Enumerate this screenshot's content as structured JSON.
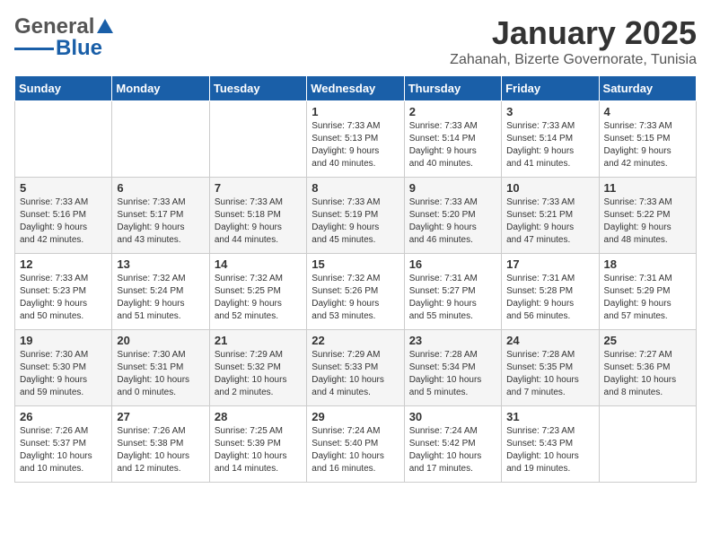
{
  "header": {
    "logo_general": "General",
    "logo_blue": "Blue",
    "month_title": "January 2025",
    "location": "Zahanah, Bizerte Governorate, Tunisia"
  },
  "days_of_week": [
    "Sunday",
    "Monday",
    "Tuesday",
    "Wednesday",
    "Thursday",
    "Friday",
    "Saturday"
  ],
  "weeks": [
    [
      {
        "day": "",
        "info": ""
      },
      {
        "day": "",
        "info": ""
      },
      {
        "day": "",
        "info": ""
      },
      {
        "day": "1",
        "info": "Sunrise: 7:33 AM\nSunset: 5:13 PM\nDaylight: 9 hours\nand 40 minutes."
      },
      {
        "day": "2",
        "info": "Sunrise: 7:33 AM\nSunset: 5:14 PM\nDaylight: 9 hours\nand 40 minutes."
      },
      {
        "day": "3",
        "info": "Sunrise: 7:33 AM\nSunset: 5:14 PM\nDaylight: 9 hours\nand 41 minutes."
      },
      {
        "day": "4",
        "info": "Sunrise: 7:33 AM\nSunset: 5:15 PM\nDaylight: 9 hours\nand 42 minutes."
      }
    ],
    [
      {
        "day": "5",
        "info": "Sunrise: 7:33 AM\nSunset: 5:16 PM\nDaylight: 9 hours\nand 42 minutes."
      },
      {
        "day": "6",
        "info": "Sunrise: 7:33 AM\nSunset: 5:17 PM\nDaylight: 9 hours\nand 43 minutes."
      },
      {
        "day": "7",
        "info": "Sunrise: 7:33 AM\nSunset: 5:18 PM\nDaylight: 9 hours\nand 44 minutes."
      },
      {
        "day": "8",
        "info": "Sunrise: 7:33 AM\nSunset: 5:19 PM\nDaylight: 9 hours\nand 45 minutes."
      },
      {
        "day": "9",
        "info": "Sunrise: 7:33 AM\nSunset: 5:20 PM\nDaylight: 9 hours\nand 46 minutes."
      },
      {
        "day": "10",
        "info": "Sunrise: 7:33 AM\nSunset: 5:21 PM\nDaylight: 9 hours\nand 47 minutes."
      },
      {
        "day": "11",
        "info": "Sunrise: 7:33 AM\nSunset: 5:22 PM\nDaylight: 9 hours\nand 48 minutes."
      }
    ],
    [
      {
        "day": "12",
        "info": "Sunrise: 7:33 AM\nSunset: 5:23 PM\nDaylight: 9 hours\nand 50 minutes."
      },
      {
        "day": "13",
        "info": "Sunrise: 7:32 AM\nSunset: 5:24 PM\nDaylight: 9 hours\nand 51 minutes."
      },
      {
        "day": "14",
        "info": "Sunrise: 7:32 AM\nSunset: 5:25 PM\nDaylight: 9 hours\nand 52 minutes."
      },
      {
        "day": "15",
        "info": "Sunrise: 7:32 AM\nSunset: 5:26 PM\nDaylight: 9 hours\nand 53 minutes."
      },
      {
        "day": "16",
        "info": "Sunrise: 7:31 AM\nSunset: 5:27 PM\nDaylight: 9 hours\nand 55 minutes."
      },
      {
        "day": "17",
        "info": "Sunrise: 7:31 AM\nSunset: 5:28 PM\nDaylight: 9 hours\nand 56 minutes."
      },
      {
        "day": "18",
        "info": "Sunrise: 7:31 AM\nSunset: 5:29 PM\nDaylight: 9 hours\nand 57 minutes."
      }
    ],
    [
      {
        "day": "19",
        "info": "Sunrise: 7:30 AM\nSunset: 5:30 PM\nDaylight: 9 hours\nand 59 minutes."
      },
      {
        "day": "20",
        "info": "Sunrise: 7:30 AM\nSunset: 5:31 PM\nDaylight: 10 hours\nand 0 minutes."
      },
      {
        "day": "21",
        "info": "Sunrise: 7:29 AM\nSunset: 5:32 PM\nDaylight: 10 hours\nand 2 minutes."
      },
      {
        "day": "22",
        "info": "Sunrise: 7:29 AM\nSunset: 5:33 PM\nDaylight: 10 hours\nand 4 minutes."
      },
      {
        "day": "23",
        "info": "Sunrise: 7:28 AM\nSunset: 5:34 PM\nDaylight: 10 hours\nand 5 minutes."
      },
      {
        "day": "24",
        "info": "Sunrise: 7:28 AM\nSunset: 5:35 PM\nDaylight: 10 hours\nand 7 minutes."
      },
      {
        "day": "25",
        "info": "Sunrise: 7:27 AM\nSunset: 5:36 PM\nDaylight: 10 hours\nand 8 minutes."
      }
    ],
    [
      {
        "day": "26",
        "info": "Sunrise: 7:26 AM\nSunset: 5:37 PM\nDaylight: 10 hours\nand 10 minutes."
      },
      {
        "day": "27",
        "info": "Sunrise: 7:26 AM\nSunset: 5:38 PM\nDaylight: 10 hours\nand 12 minutes."
      },
      {
        "day": "28",
        "info": "Sunrise: 7:25 AM\nSunset: 5:39 PM\nDaylight: 10 hours\nand 14 minutes."
      },
      {
        "day": "29",
        "info": "Sunrise: 7:24 AM\nSunset: 5:40 PM\nDaylight: 10 hours\nand 16 minutes."
      },
      {
        "day": "30",
        "info": "Sunrise: 7:24 AM\nSunset: 5:42 PM\nDaylight: 10 hours\nand 17 minutes."
      },
      {
        "day": "31",
        "info": "Sunrise: 7:23 AM\nSunset: 5:43 PM\nDaylight: 10 hours\nand 19 minutes."
      },
      {
        "day": "",
        "info": ""
      }
    ]
  ]
}
